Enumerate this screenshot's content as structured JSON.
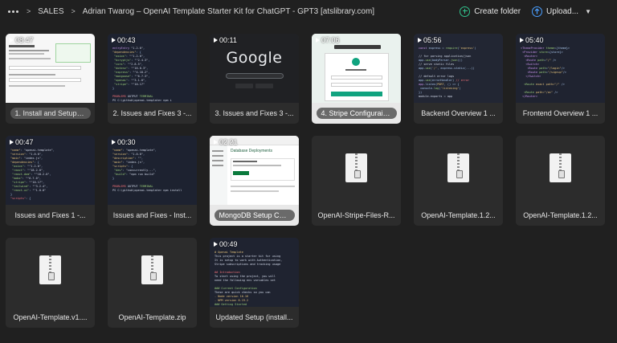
{
  "breadcrumb": {
    "more_label": "•••",
    "items": [
      "SALES",
      "Adrian Twarog – OpenAI Template Starter Kit for ChatGPT - GPT3 [atslibrary.com]"
    ]
  },
  "actions": {
    "create_folder": "Create folder",
    "upload": "Upload...",
    "accent_create": "#31c48d",
    "accent_upload": "#4a9eff"
  },
  "files": [
    {
      "name": "1. Install and Setup (u...",
      "duration": "08:47",
      "kind": "video",
      "thumb": "webpage"
    },
    {
      "name": "2. Issues and Fixes 3 -...",
      "duration": "00:43",
      "kind": "video",
      "thumb": "code"
    },
    {
      "name": "3. Issues and Fixes 3 -...",
      "duration": "00:11",
      "kind": "video",
      "thumb": "google",
      "thumb_text": "Google"
    },
    {
      "name": "4. Stripe Configuraito...",
      "duration": "07:06",
      "kind": "video",
      "thumb": "webpage",
      "selected": true
    },
    {
      "name": "Backend Overview 1 ...",
      "duration": "05:56",
      "kind": "video",
      "thumb": "code"
    },
    {
      "name": "Frontend Overview 1 ...",
      "duration": "05:40",
      "kind": "video",
      "thumb": "code"
    },
    {
      "name": "Issues and Fixes 1 -...",
      "duration": "00:47",
      "kind": "video",
      "thumb": "code"
    },
    {
      "name": "Issues and Fixes - Inst...",
      "duration": "00:30",
      "kind": "video",
      "thumb": "code"
    },
    {
      "name": "MongoDB Setup Con...",
      "duration": "02:21",
      "kind": "video",
      "thumb": "webpage",
      "thumb_text": "Database Deployments"
    },
    {
      "name": "OpenAI-Stripe-Files-R...",
      "kind": "zip"
    },
    {
      "name": "OpenAI-Template.1.2...",
      "kind": "zip"
    },
    {
      "name": "OpenAI-Template.1.2...",
      "kind": "zip"
    },
    {
      "name": "OpenAI-Template.v1....",
      "kind": "zip"
    },
    {
      "name": "OpenAI-Template.zip",
      "kind": "zip"
    },
    {
      "name": "Updated Setup (install...",
      "duration": "00:49",
      "kind": "video",
      "thumb": "code"
    }
  ]
}
